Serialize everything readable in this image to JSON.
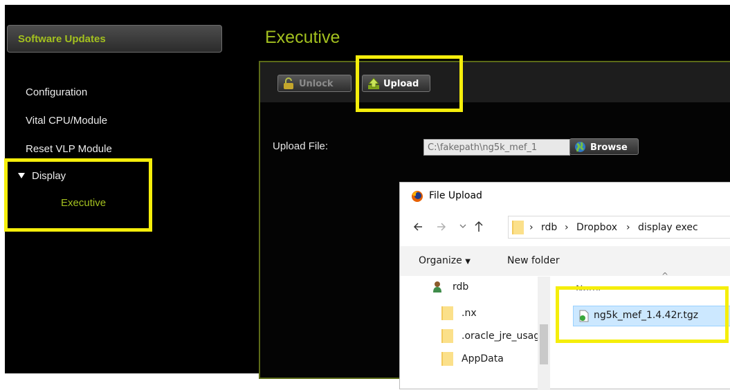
{
  "sidebar": {
    "header": "Software Updates",
    "items": [
      {
        "label": "Configuration"
      },
      {
        "label": "Vital CPU/Module"
      },
      {
        "label": "Reset VLP Module"
      },
      {
        "label": "Display"
      },
      {
        "label": "Executive"
      }
    ]
  },
  "main": {
    "title": "Executive",
    "toolbar": {
      "unlock_label": "Unlock",
      "upload_label": "Upload"
    },
    "upload_file_label": "Upload File:",
    "file_path_value": "C:\\fakepath\\ng5k_mef_1",
    "browse_label": "Browse"
  },
  "dialog": {
    "title": "File Upload",
    "breadcrumb": [
      "rdb",
      "Dropbox",
      "display exec"
    ],
    "commands": {
      "organize": "Organize",
      "new_folder": "New folder"
    },
    "tree": [
      {
        "label": "rdb",
        "icon": "user-folder-icon"
      },
      {
        "label": ".nx",
        "icon": "folder-icon"
      },
      {
        "label": ".oracle_jre_usag",
        "icon": "folder-icon"
      },
      {
        "label": "AppData",
        "icon": "folder-icon"
      }
    ],
    "column_header": "Name",
    "files": [
      {
        "name": "ng5k_mef_1.4.42r.tgz",
        "icon": "tgz-file-icon"
      }
    ]
  },
  "colors": {
    "accent": "#a3c01f",
    "highlight": "#f5ee0b",
    "background": "#000000",
    "selection": "#cce8ff"
  }
}
